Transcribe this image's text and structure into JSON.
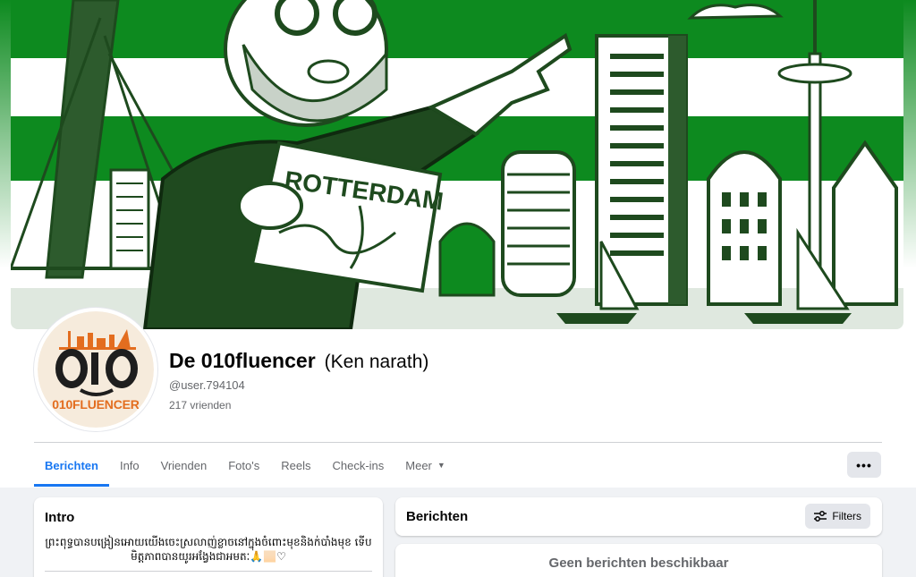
{
  "cover": {
    "map_text": "ROTTERDAM",
    "colors": {
      "green": "#0d8a1f",
      "dark_green": "#1e4a1e",
      "light": "#ffffff"
    }
  },
  "profile": {
    "avatar_text": "010FLUENCER",
    "avatar_numbers": "010",
    "name": "De 010fluencer",
    "alternate_name": "(Ken narath)",
    "handle": "@user.794104",
    "friends": "217 vrienden"
  },
  "tabs": [
    {
      "label": "Berichten",
      "active": true
    },
    {
      "label": "Info",
      "active": false
    },
    {
      "label": "Vrienden",
      "active": false
    },
    {
      "label": "Foto's",
      "active": false
    },
    {
      "label": "Reels",
      "active": false
    },
    {
      "label": "Check-ins",
      "active": false
    },
    {
      "label": "Meer",
      "active": false
    }
  ],
  "more_button": {
    "label": "•••"
  },
  "intro": {
    "title": "Intro",
    "bio": "ព្រះពុទ្ធបានបង្រៀនអោយយើងចេះស្រលាញ់ខ្លាចនៅក្នុងចំពោះមុខនិងក់បាំងមុខ ទើបមិត្តភាពបានយូរអង្វែងជាអមតៈ🙏🏻♡"
  },
  "posts": {
    "title": "Berichten",
    "filters_label": "Filters",
    "empty_text": "Geen berichten beschikbaar"
  },
  "colors": {
    "accent": "#1877f2",
    "muted": "#65676b",
    "page_bg": "#f0f2f5"
  }
}
